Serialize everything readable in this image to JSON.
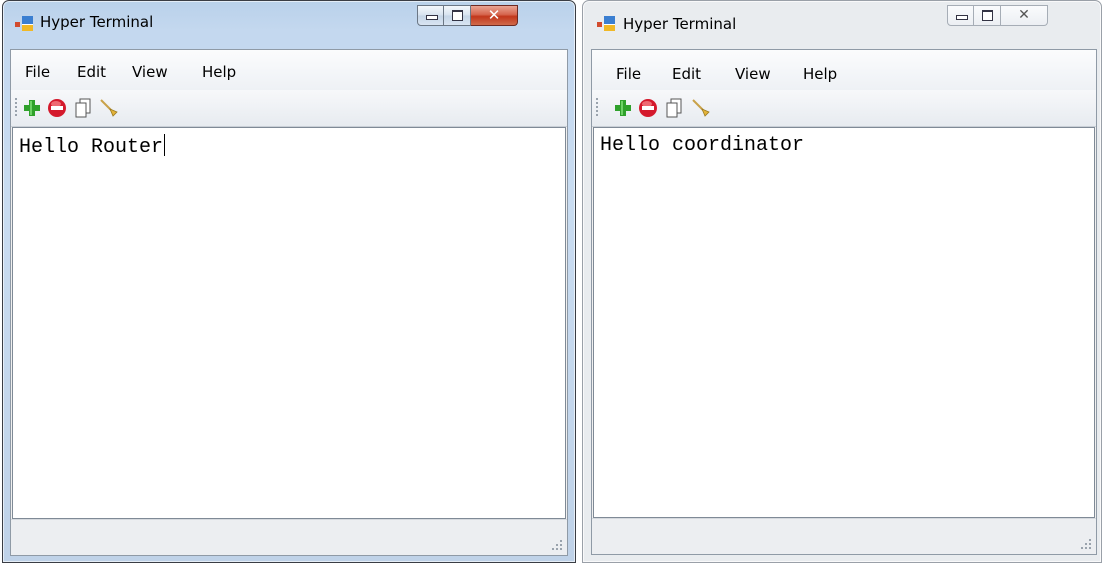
{
  "windows": [
    {
      "title": "Hyper Terminal",
      "menu": [
        "File",
        "Edit",
        "View",
        "Help"
      ],
      "toolbar": [
        "add-icon",
        "remove-icon",
        "copy-icon",
        "clear-brush-icon"
      ],
      "terminal_text": "Hello Router",
      "active": true
    },
    {
      "title": "Hyper Terminal",
      "menu": [
        "File",
        "Edit",
        "View",
        "Help"
      ],
      "toolbar": [
        "add-icon",
        "remove-icon",
        "copy-icon",
        "clear-brush-icon"
      ],
      "terminal_text": "Hello coordinator",
      "active": false
    }
  ],
  "colors": {
    "active_frame": "#c4d8ef",
    "inactive_frame": "#e9ecef",
    "close_button_active": "#c2371b",
    "add_icon": "#2fa12b",
    "remove_icon": "#d4192c"
  }
}
